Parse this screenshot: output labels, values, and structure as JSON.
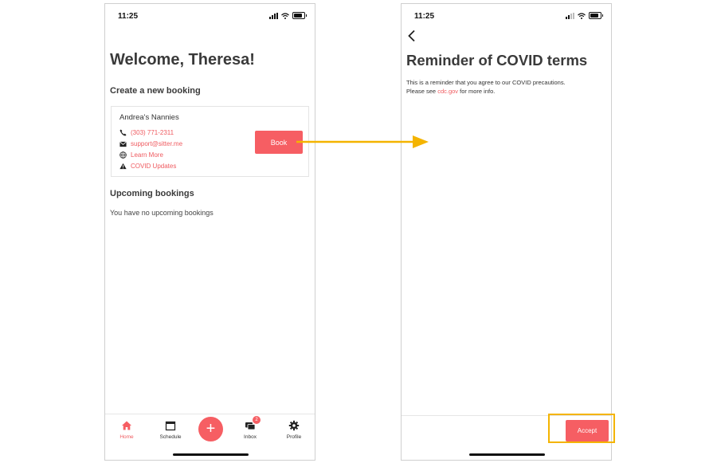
{
  "home_screen": {
    "status_time": "11:25",
    "welcome_title": "Welcome, Theresa!",
    "create_booking_title": "Create a new booking",
    "card": {
      "provider_name": "Andrea's Nannies",
      "phone": "(303) 771-2311",
      "email": "support@sitter.me",
      "learn_more": "Learn More",
      "covid_updates": "COVID Updates",
      "book_label": "Book"
    },
    "upcoming_title": "Upcoming bookings",
    "upcoming_empty": "You have no upcoming bookings",
    "tabs": [
      {
        "label": "Home",
        "icon": "home-icon",
        "active": true
      },
      {
        "label": "Schedule",
        "icon": "calendar-icon",
        "active": false
      },
      {
        "label": "+",
        "icon": "plus-icon",
        "active": false
      },
      {
        "label": "Inbox",
        "icon": "chat-icon",
        "active": false,
        "badge": "2"
      },
      {
        "label": "Profile",
        "icon": "gear-icon",
        "active": false
      }
    ]
  },
  "reminder_screen": {
    "status_time": "11:25",
    "title": "Reminder of COVID terms",
    "body_line1": "This is a reminder that you agree to our COVID precautions.",
    "body_prefix": "Please see ",
    "body_link": "cdc.gov",
    "body_suffix": " for more info.",
    "accept_label": "Accept"
  },
  "colors": {
    "accent": "#f65e63",
    "link": "#ef5a5f",
    "annotation": "#f4b400"
  }
}
